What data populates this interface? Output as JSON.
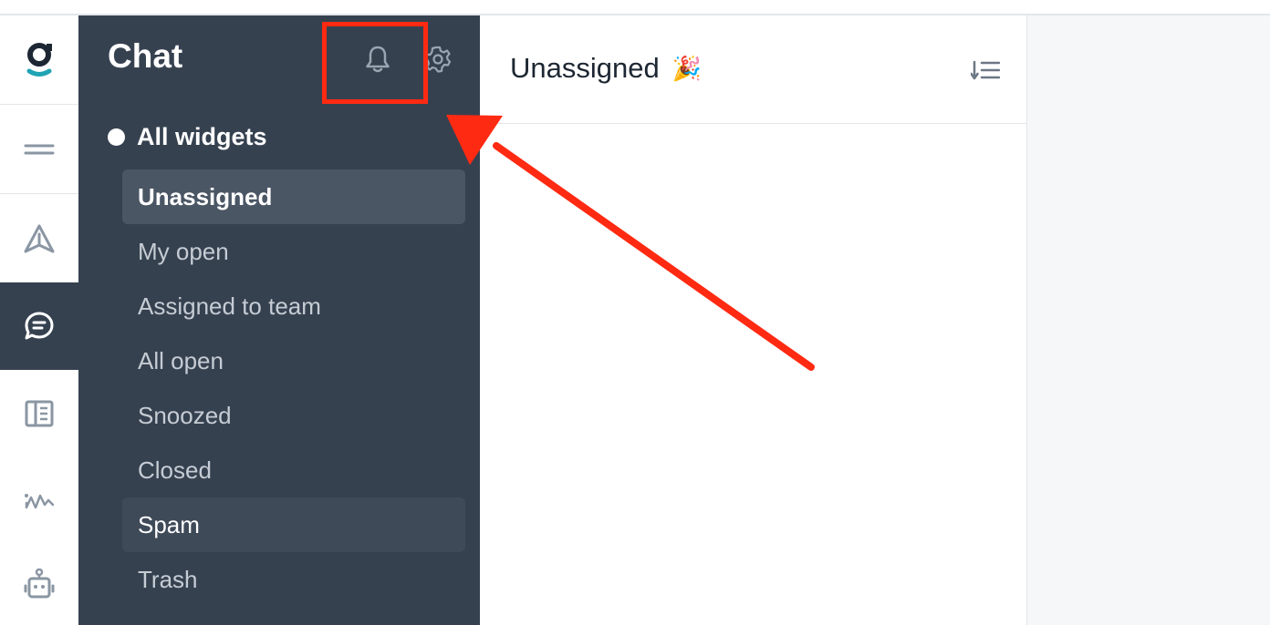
{
  "sidebar": {
    "title": "Chat",
    "notifications_icon": "bell-icon",
    "settings_icon": "gear-icon",
    "widgets_label": "All widgets",
    "items": [
      {
        "label": "Unassigned",
        "state": "selected"
      },
      {
        "label": "My open"
      },
      {
        "label": "Assigned to team"
      },
      {
        "label": "All open"
      },
      {
        "label": "Snoozed"
      },
      {
        "label": "Closed"
      },
      {
        "label": "Spam",
        "state": "hover"
      },
      {
        "label": "Trash"
      }
    ]
  },
  "rail": {
    "icons": [
      "logo-icon",
      "menu-icon",
      "send-icon",
      "chat-icon",
      "knowledge-base-icon",
      "analytics-icon",
      "bot-icon"
    ],
    "active": "chat-icon"
  },
  "main": {
    "title": "Unassigned",
    "title_emoji": "🎉",
    "sort_icon": "sort-icon"
  },
  "colors": {
    "sidebar_bg": "#364150",
    "selected_bg": "#4b5665",
    "annotation": "#ff2a12",
    "accent_teal": "#1fa3b3"
  }
}
